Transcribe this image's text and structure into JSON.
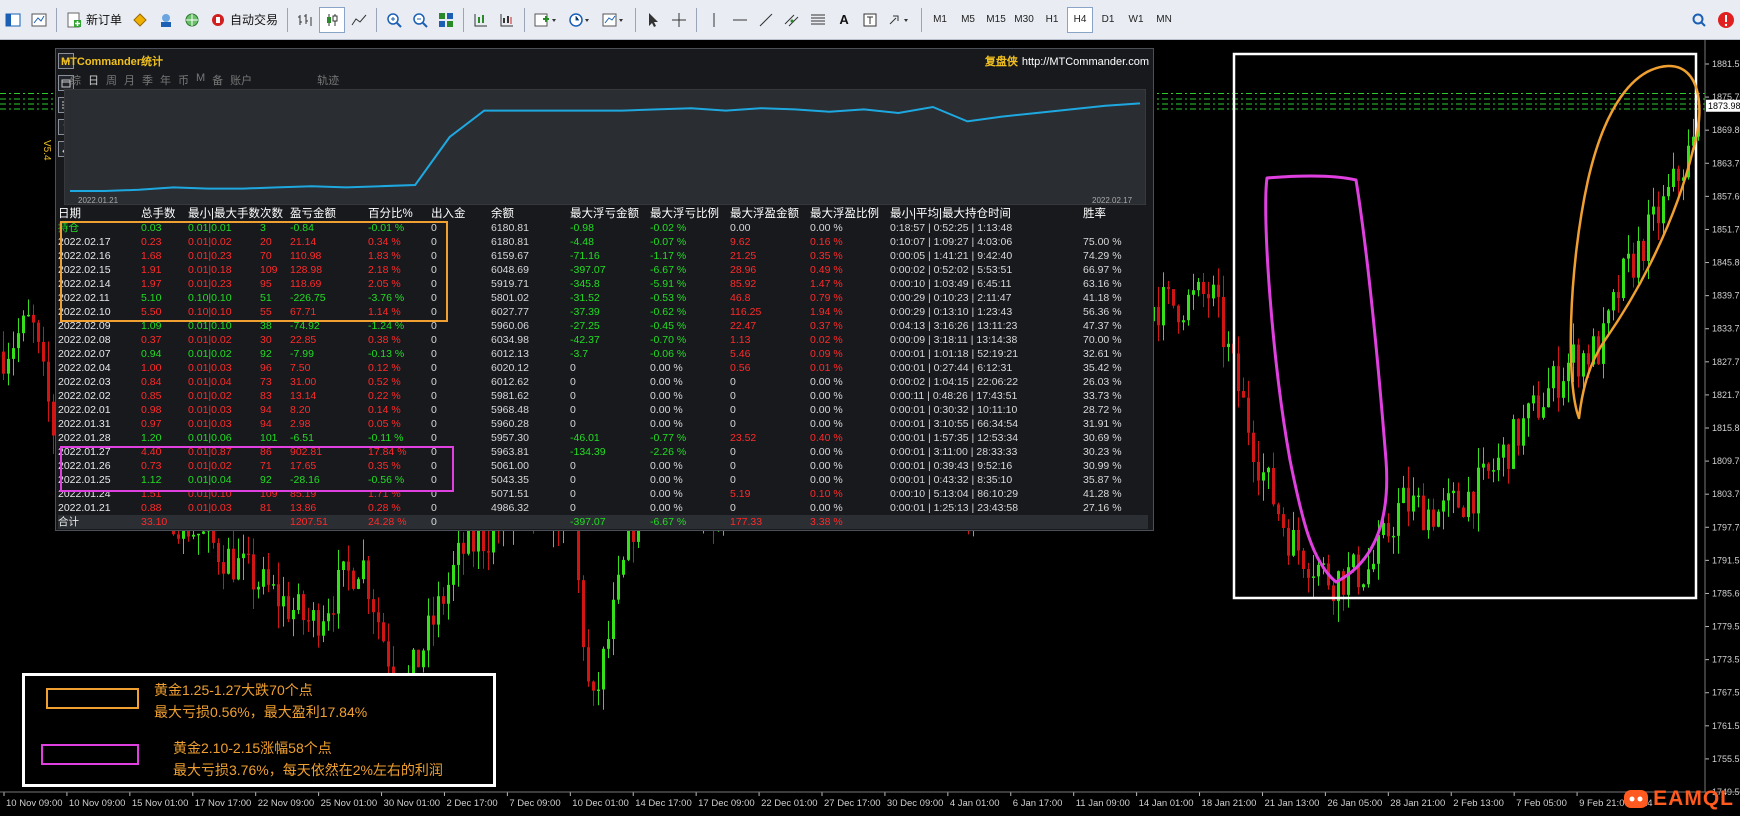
{
  "toolbar": {
    "new_order_label": "新订单",
    "auto_trade_label": "自动交易",
    "text_tool_label": "A",
    "timeframes": [
      "M1",
      "M5",
      "M15",
      "M30",
      "H1",
      "H4",
      "D1",
      "W1",
      "MN"
    ],
    "selected_timeframe": "H4"
  },
  "chart": {
    "background": "#000000",
    "bull_color": "#33e01a",
    "bear_color": "#d01515",
    "side_label": "V5.4",
    "price_labels": [
      "1881.55",
      "1875.70",
      "1869.80",
      "1863.70",
      "1857.60",
      "1851.70",
      "1845.80",
      "1839.75",
      "1833.70",
      "1827.75",
      "1821.70",
      "1815.85",
      "1809.70",
      "1803.70",
      "1797.70",
      "1791.55",
      "1785.60",
      "1779.55",
      "1773.55",
      "1767.55",
      "1761.55",
      "1755.55",
      "1749.55"
    ],
    "current_price": "1873.98",
    "time_labels": [
      "10 Nov 09:00",
      "10 Nov 09:00",
      "15 Nov 01:00",
      "17 Nov 17:00",
      "22 Nov 09:00",
      "25 Nov 01:00",
      "30 Nov 01:00",
      "2 Dec 17:00",
      "7 Dec 09:00",
      "10 Dec 01:00",
      "14 Dec 17:00",
      "17 Dec 09:00",
      "22 Dec 01:00",
      "27 Dec 17:00",
      "30 Dec 09:00",
      "4 Jan 01:00",
      "6 Jan 17:00",
      "11 Jan 09:00",
      "14 Jan 01:00",
      "18 Jan 21:00",
      "21 Jan 13:00",
      "26 Jan 05:00",
      "28 Jan 21:00",
      "2 Feb 13:00",
      "7 Feb 05:00",
      "9 Feb 21:00",
      "14"
    ]
  },
  "stats_panel": {
    "title": "MTCommander统计",
    "brand": "复盘侠",
    "site": "http://MTCommander.com",
    "tabs": [
      "综",
      "日",
      "周",
      "月",
      "季",
      "年",
      "币",
      "M",
      "备",
      "账户"
    ],
    "active_tab": "日",
    "track_tab": "轨迹",
    "mini_chart_start": "2022.01.21",
    "mini_chart_end": "2022.02.17",
    "mini_chart_values": [
      5,
      5,
      6,
      8,
      7,
      7,
      8,
      9,
      8,
      9,
      10,
      50,
      72,
      72,
      72,
      72,
      72,
      73,
      74,
      72,
      74,
      73,
      71,
      73,
      70,
      75,
      63,
      67,
      70,
      73,
      76,
      78
    ],
    "headers": [
      "日期",
      "总手数",
      "最小|最大手数",
      "次数",
      "盈亏金额",
      "百分比%",
      "出入金",
      "余额",
      "最大浮亏金额",
      "最大浮亏比例",
      "最大浮盈金额",
      "最大浮盈比例",
      "最小|平均|最大持仓时间",
      "胜率"
    ],
    "rows": [
      [
        "持仓",
        "0.03",
        "0.01|0.01",
        "3",
        "-0.84",
        "-0.01 %",
        "0",
        "6180.81",
        "-0.98",
        "-0.02 %",
        "0.00",
        "0.00 %",
        "0:18:57 | 0:52:25 | 1:13:48",
        ""
      ],
      [
        "2022.02.17",
        "0.23",
        "0.01|0.02",
        "20",
        "21.14",
        "0.34 %",
        "0",
        "6180.81",
        "-4.48",
        "-0.07 %",
        "9.62",
        "0.16 %",
        "0:10:07 | 1:09:27 | 4:03:06",
        "75.00 %"
      ],
      [
        "2022.02.16",
        "1.68",
        "0.01|0.23",
        "70",
        "110.98",
        "1.83 %",
        "0",
        "6159.67",
        "-71.16",
        "-1.17 %",
        "21.25",
        "0.35 %",
        "0:00:05 | 1:41:21 | 9:42:40",
        "74.29 %"
      ],
      [
        "2022.02.15",
        "1.91",
        "0.01|0.18",
        "109",
        "128.98",
        "2.18 %",
        "0",
        "6048.69",
        "-397.07",
        "-6.67 %",
        "28.96",
        "0.49 %",
        "0:00:02 | 0:52:02 | 5:53:51",
        "66.97 %"
      ],
      [
        "2022.02.14",
        "1.97",
        "0.01|0.23",
        "95",
        "118.69",
        "2.05 %",
        "0",
        "5919.71",
        "-345.8",
        "-5.91 %",
        "85.92",
        "1.47 %",
        "0:00:10 | 1:03:49 | 6:45:11",
        "63.16 %"
      ],
      [
        "2022.02.11",
        "5.10",
        "0.10|0.10",
        "51",
        "-226.75",
        "-3.76 %",
        "0",
        "5801.02",
        "-31.52",
        "-0.53 %",
        "46.8",
        "0.79 %",
        "0:00:29 | 0:10:23 | 2:11:47",
        "41.18 %"
      ],
      [
        "2022.02.10",
        "5.50",
        "0.10|0.10",
        "55",
        "67.71",
        "1.14 %",
        "0",
        "6027.77",
        "-37.39",
        "-0.62 %",
        "116.25",
        "1.94 %",
        "0:00:29 | 0:13:10 | 1:23:43",
        "56.36 %"
      ],
      [
        "2022.02.09",
        "1.09",
        "0.01|0.10",
        "38",
        "-74.92",
        "-1.24 %",
        "0",
        "5960.06",
        "-27.25",
        "-0.45 %",
        "22.47",
        "0.37 %",
        "0:04:13 | 3:16:26 | 13:11:23",
        "47.37 %"
      ],
      [
        "2022.02.08",
        "0.37",
        "0.01|0.02",
        "30",
        "22.85",
        "0.38 %",
        "0",
        "6034.98",
        "-42.37",
        "-0.70 %",
        "1.13",
        "0.02 %",
        "0:00:09 | 3:18:11 | 13:14:38",
        "70.00 %"
      ],
      [
        "2022.02.07",
        "0.94",
        "0.01|0.02",
        "92",
        "-7.99",
        "-0.13 %",
        "0",
        "6012.13",
        "-3.7",
        "-0.06 %",
        "5.46",
        "0.09 %",
        "0:00:01 | 1:01:18 | 52:19:21",
        "32.61 %"
      ],
      [
        "2022.02.04",
        "1.00",
        "0.01|0.03",
        "96",
        "7.50",
        "0.12 %",
        "0",
        "6020.12",
        "0",
        "0.00 %",
        "0.56",
        "0.01 %",
        "0:00:01 | 0:27:44 | 6:12:31",
        "35.42 %"
      ],
      [
        "2022.02.03",
        "0.84",
        "0.01|0.04",
        "73",
        "31.00",
        "0.52 %",
        "0",
        "6012.62",
        "0",
        "0.00 %",
        "0",
        "0.00 %",
        "0:00:02 | 1:04:15 | 22:06:22",
        "26.03 %"
      ],
      [
        "2022.02.02",
        "0.85",
        "0.01|0.02",
        "83",
        "13.14",
        "0.22 %",
        "0",
        "5981.62",
        "0",
        "0.00 %",
        "0",
        "0.00 %",
        "0:00:11 | 0:48:26 | 17:43:51",
        "33.73 %"
      ],
      [
        "2022.02.01",
        "0.98",
        "0.01|0.03",
        "94",
        "8.20",
        "0.14 %",
        "0",
        "5968.48",
        "0",
        "0.00 %",
        "0",
        "0.00 %",
        "0:00:01 | 0:30:32 | 10:11:10",
        "28.72 %"
      ],
      [
        "2022.01.31",
        "0.97",
        "0.01|0.03",
        "94",
        "2.98",
        "0.05 %",
        "0",
        "5960.28",
        "0",
        "0.00 %",
        "0",
        "0.00 %",
        "0:00:01 | 3:10:55 | 66:34:54",
        "31.91 %"
      ],
      [
        "2022.01.28",
        "1.20",
        "0.01|0.06",
        "101",
        "-6.51",
        "-0.11 %",
        "0",
        "5957.30",
        "-46.01",
        "-0.77 %",
        "23.52",
        "0.40 %",
        "0:00:01 | 1:57:35 | 12:53:34",
        "30.69 %"
      ],
      [
        "2022.01.27",
        "4.40",
        "0.01|0.87",
        "86",
        "902.81",
        "17.84 %",
        "0",
        "5963.81",
        "-134.39",
        "-2.26 %",
        "0",
        "0.00 %",
        "0:00:01 | 3:11:00 | 28:33:33",
        "30.23 %"
      ],
      [
        "2022.01.26",
        "0.73",
        "0.01|0.02",
        "71",
        "17.65",
        "0.35 %",
        "0",
        "5061.00",
        "0",
        "0.00 %",
        "0",
        "0.00 %",
        "0:00:01 | 0:39:43 | 9:52:16",
        "30.99 %"
      ],
      [
        "2022.01.25",
        "1.12",
        "0.01|0.04",
        "92",
        "-28.16",
        "-0.56 %",
        "0",
        "5043.35",
        "0",
        "0.00 %",
        "0",
        "0.00 %",
        "0:00:01 | 0:43:32 | 8:35:10",
        "35.87 %"
      ],
      [
        "2022.01.24",
        "1.51",
        "0.01|0.10",
        "109",
        "85.19",
        "1.71 %",
        "0",
        "5071.51",
        "0",
        "0.00 %",
        "5.19",
        "0.10 %",
        "0:00:10 | 5:13:04 | 86:10:29",
        "41.28 %"
      ],
      [
        "2022.01.21",
        "0.88",
        "0.01|0.03",
        "81",
        "13.86",
        "0.28 %",
        "0",
        "4986.32",
        "0",
        "0.00 %",
        "0",
        "0.00 %",
        "0:00:01 | 1:25:13 | 23:43:58",
        "27.16 %"
      ]
    ],
    "total": [
      "合计",
      "33.10",
      "",
      "",
      "1207.51",
      "24.28 %",
      "0",
      "",
      "-397.07",
      "-6.67 %",
      "177.33",
      "3.38 %",
      "",
      ""
    ]
  },
  "legend": {
    "orange_color": "#f0a030",
    "magenta_color": "#e040e0",
    "orange_line1": "黄金1.25-1.27大跌70个点",
    "orange_line2": "最大亏损0.56%，最大盈利17.84%",
    "magenta_line1": "黄金2.10-2.15涨幅58个点",
    "magenta_line2": "最大亏损3.76%，每天依然在2%左右的利润"
  },
  "watermark": {
    "text": "EAMQL"
  }
}
